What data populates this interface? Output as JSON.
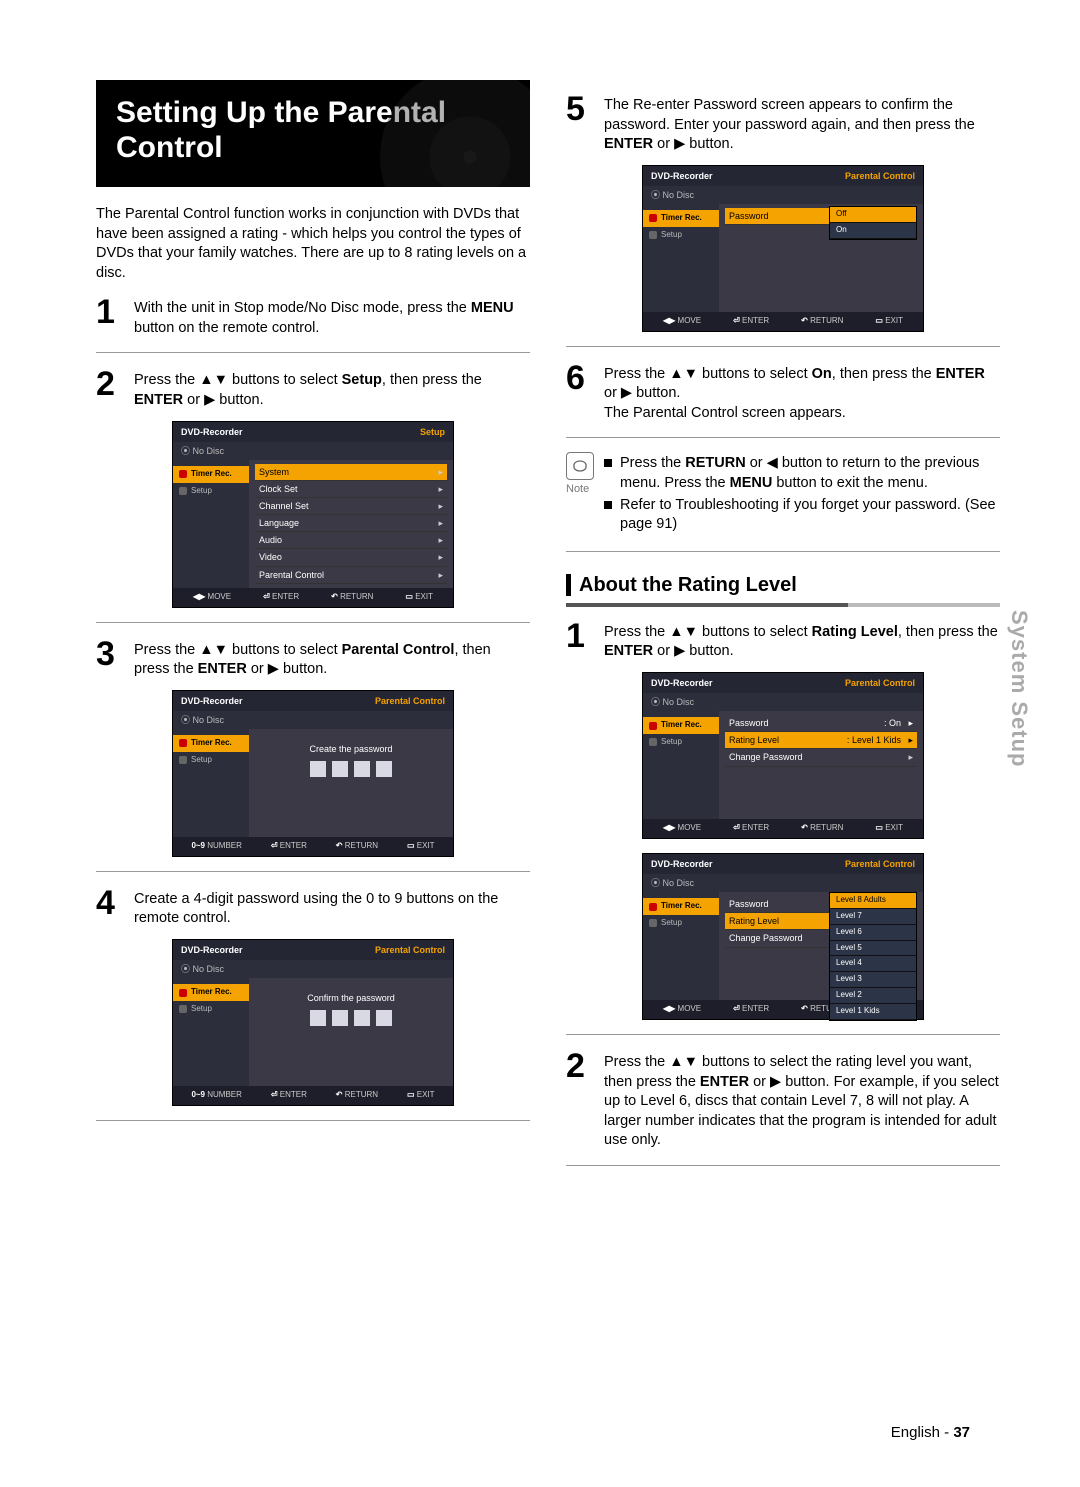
{
  "title": "Setting Up the Parental Control",
  "sidetab": "System Setup",
  "footer_lang": "English",
  "footer_page": "37",
  "intro": "The Parental Control function works in conjunction with DVDs that have been assigned a rating - which helps you control the types of DVDs that your family watches. There are up to 8 rating levels on a disc.",
  "left_steps": {
    "1": {
      "a": "With the unit in Stop mode/No Disc mode, press the ",
      "b": "MENU",
      "c": " button on the remote control."
    },
    "2": {
      "a": "Press the ▲▼ buttons to select ",
      "b": "Setup",
      "c": ", then press the ",
      "d": "ENTER",
      "e": " or ▶ button."
    },
    "3": {
      "a": "Press the ▲▼ buttons to select ",
      "b": "Parental Control",
      "c": ", then press the ",
      "d": "ENTER",
      "e": " or ▶ button."
    },
    "4": "Create a 4-digit password using the 0 to 9 buttons on the remote control."
  },
  "right_steps": {
    "5": {
      "a": "The Re-enter Password screen appears to confirm the password. Enter your password again, and then press the ",
      "b": "ENTER",
      "c": " or ▶ button."
    },
    "6": {
      "a": "Press the ▲▼ buttons to select ",
      "b": "On",
      "c": ", then press the ",
      "d": "ENTER",
      "e": " or ▶ button.",
      "f": "The Parental Control screen appears."
    }
  },
  "note_label": "Note",
  "note_items": [
    {
      "a": "Press the ",
      "b": "RETURN",
      "c": " or ◀ button to return to the previous menu. Press the ",
      "d": "MENU",
      "e": " button to exit the menu."
    },
    {
      "a": "Refer to Troubleshooting if you forget your password. (See page 91)"
    }
  ],
  "section2": "About the Rating Level",
  "rating_steps": {
    "1": {
      "a": "Press the ▲▼ buttons to select ",
      "b": "Rating Level",
      "c": ", then press the ",
      "d": "ENTER",
      "e": " or ▶ button."
    },
    "2": {
      "a": "Press the ▲▼ buttons to select the rating level you want, then press the ",
      "b": "ENTER",
      "c": " or ▶ button.",
      "d": "For example, if you select up to Level 6, discs that contain Level 7, 8 will not play. A larger number indicates that the program is intended for adult use only."
    }
  },
  "osd": {
    "head": "DVD-Recorder",
    "nodisc": "No Disc",
    "nav_timer": "Timer Rec.",
    "nav_setup": "Setup",
    "titles": {
      "setup": "Setup",
      "parental": "Parental Control"
    },
    "setup_rows": [
      "System",
      "Clock Set",
      "Channel Set",
      "Language",
      "Audio",
      "Video",
      "Parental Control"
    ],
    "pw_create": "Create the password",
    "pw_confirm": "Confirm the password",
    "password": "Password",
    "rating_level": "Rating Level",
    "change_pw": "Change Password",
    "on": "On",
    "off": "Off",
    "level_val": "Level 1 Kids",
    "levels": [
      "Level 8 Adults",
      "Level 7",
      "Level 6",
      "Level 5",
      "Level 4",
      "Level 3",
      "Level 2",
      "Level 1 Kids"
    ],
    "foot": {
      "move": "MOVE",
      "enter": "ENTER",
      "return": "RETURN",
      "exit": "EXIT",
      "number": "NUMBER",
      "pre_move": "◀▶",
      "pre_enter": "⏎",
      "pre_return": "↶",
      "pre_exit": "▭",
      "pre_number": "0~9"
    }
  }
}
